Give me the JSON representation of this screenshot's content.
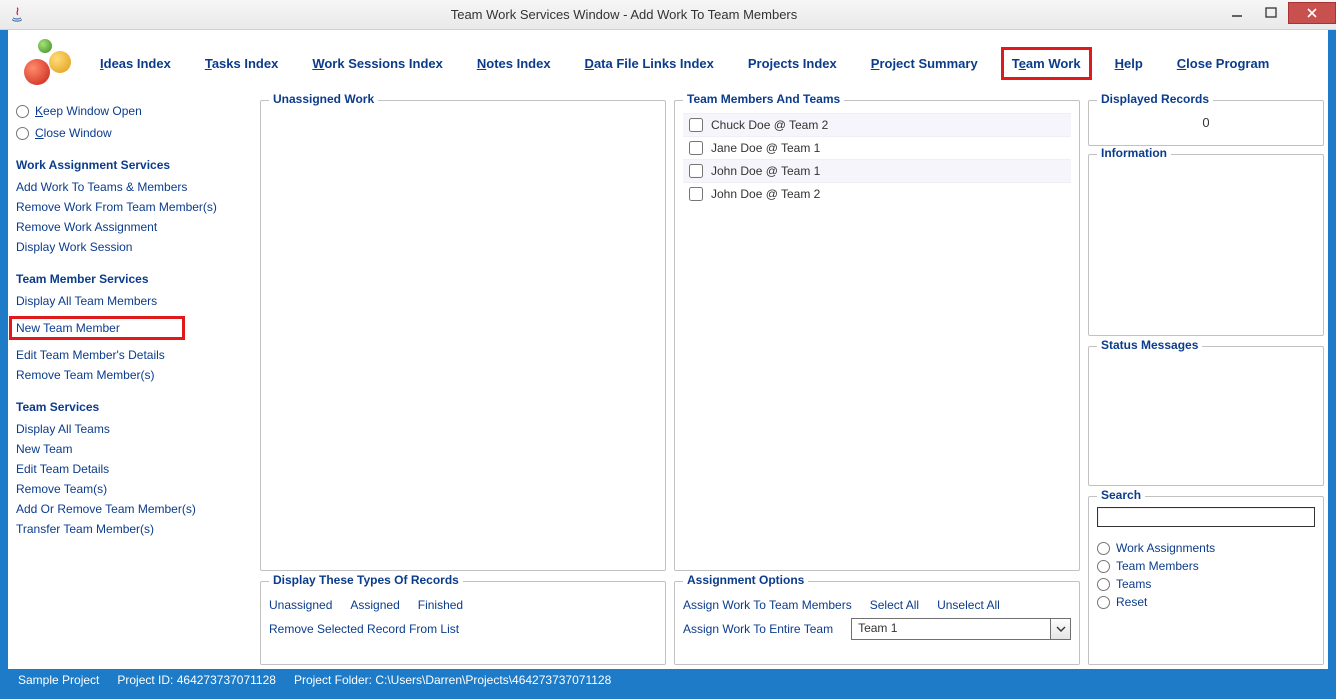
{
  "window": {
    "title": "Team Work Services Window - Add Work To Team Members"
  },
  "menu": [
    {
      "pre": "",
      "mn": "I",
      "post": "deas Index"
    },
    {
      "pre": "",
      "mn": "T",
      "post": "asks Index"
    },
    {
      "pre": "",
      "mn": "W",
      "post": "ork Sessions Index"
    },
    {
      "pre": "",
      "mn": "N",
      "post": "otes Index"
    },
    {
      "pre": "",
      "mn": "D",
      "post": "ata File Links Index"
    },
    {
      "pre": "Pro",
      "mn": "j",
      "post": "ects Index"
    },
    {
      "pre": "",
      "mn": "P",
      "post": "roject Summary"
    },
    {
      "pre": "T",
      "mn": "e",
      "post": "am Work",
      "highlight": true
    },
    {
      "pre": "",
      "mn": "H",
      "post": "elp"
    },
    {
      "pre": "",
      "mn": "C",
      "post": "lose Program"
    }
  ],
  "sidebar": {
    "radios": {
      "keep": {
        "pre": "",
        "mn": "K",
        "post": "eep Window Open"
      },
      "close": {
        "pre": "",
        "mn": "C",
        "post": "lose Window"
      }
    },
    "sections": [
      {
        "title": "Work Assignment Services",
        "items": [
          "Add Work To Teams & Members",
          "Remove Work From Team Member(s)",
          "Remove Work Assignment",
          "Display Work Session"
        ]
      },
      {
        "title": "Team Member Services",
        "items": [
          "Display All Team Members",
          "New Team Member",
          "Edit Team Member's Details",
          "Remove Team Member(s)"
        ],
        "highlightIndex": 1
      },
      {
        "title": "Team Services",
        "items": [
          "Display All Teams",
          "New Team",
          "Edit Team Details",
          "Remove Team(s)",
          "Add Or Remove Team Member(s)",
          "Transfer Team Member(s)"
        ]
      }
    ]
  },
  "unassigned": {
    "legend": "Unassigned Work"
  },
  "members": {
    "legend": "Team Members And Teams",
    "rows": [
      "Chuck Doe @ Team 2",
      "Jane Doe @ Team 1",
      "John Doe @ Team 1",
      "John Doe @ Team 2"
    ]
  },
  "displayTypes": {
    "legend": "Display These Types Of Records",
    "options": [
      "Unassigned",
      "Assigned",
      "Finished"
    ],
    "removeLabel": "Remove Selected Record From List"
  },
  "assignOptions": {
    "legend": "Assignment Options",
    "assignMembers": "Assign Work To Team Members",
    "selectAll": "Select All",
    "unselectAll": "Unselect All",
    "assignTeam": "Assign Work To Entire Team",
    "teamValue": "Team 1"
  },
  "right": {
    "displayedRecords": {
      "legend": "Displayed Records",
      "value": "0"
    },
    "information": {
      "legend": "Information"
    },
    "statusMessages": {
      "legend": "Status Messages"
    },
    "search": {
      "legend": "Search",
      "value": "",
      "options": [
        "Work Assignments",
        "Team Members",
        "Teams",
        "Reset"
      ]
    }
  },
  "statusbar": {
    "project": "Sample Project",
    "projectIdLabel": "Project ID:",
    "projectId": "464273737071128",
    "projectFolderLabel": "Project Folder:",
    "projectFolder": "C:\\Users\\Darren\\Projects\\464273737071128"
  }
}
